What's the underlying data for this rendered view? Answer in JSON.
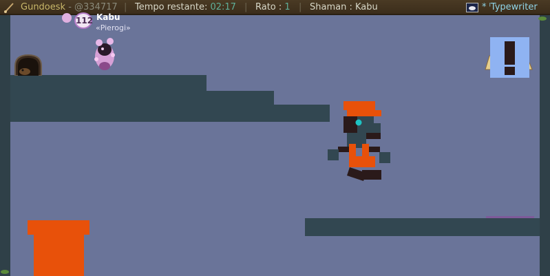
{
  "hud": {
    "player_name": "Gundoesk",
    "player_sep": " - ",
    "player_id": "@334717",
    "divider": "|",
    "time_label": "Tempo restante: ",
    "time_value": "02:17",
    "mice_label": "Rato : ",
    "mice_value": "1",
    "shaman_label": "Shaman : ",
    "shaman_value": "Kabu",
    "map_name": "* ˡTypewriter"
  },
  "player": {
    "level": "112",
    "name": "Kabu",
    "tag": "«Pierogi»"
  },
  "colors": {
    "background": "#6a7499",
    "platform": "#324751",
    "pipe": "#e8510a",
    "mystery_block": "#8fb3f2",
    "hud_gold": "#c9b86a",
    "hud_teal": "#5fb09a"
  }
}
